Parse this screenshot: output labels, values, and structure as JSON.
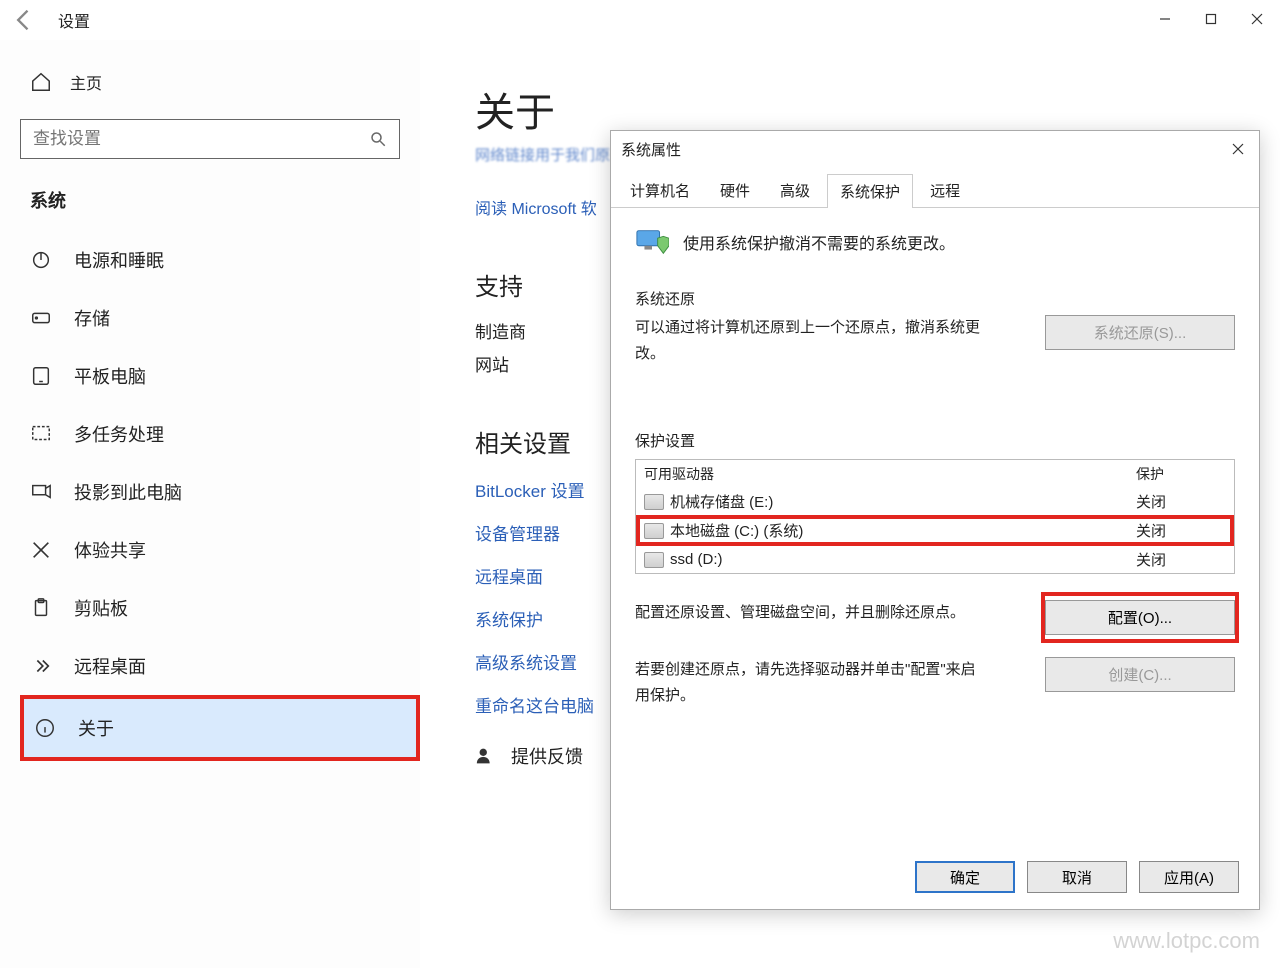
{
  "window": {
    "title": "设置"
  },
  "sidebar": {
    "home": "主页",
    "search_placeholder": "查找设置",
    "section": "系统",
    "items": [
      {
        "icon": "power-icon",
        "label": "电源和睡眠"
      },
      {
        "icon": "storage-icon",
        "label": "存储"
      },
      {
        "icon": "tablet-icon",
        "label": "平板电脑"
      },
      {
        "icon": "multitask-icon",
        "label": "多任务处理"
      },
      {
        "icon": "project-icon",
        "label": "投影到此电脑"
      },
      {
        "icon": "share-icon",
        "label": "体验共享"
      },
      {
        "icon": "clipboard-icon",
        "label": "剪贴板"
      },
      {
        "icon": "remote-icon",
        "label": "远程桌面"
      },
      {
        "icon": "info-icon",
        "label": "关于"
      }
    ]
  },
  "main": {
    "title": "关于",
    "hidden_line": "网络链接用于我们原来的 Microsoft 安全协议",
    "ms_link": "阅读 Microsoft 软",
    "support_heading": "支持",
    "manufacturer_label": "制造商",
    "website_label": "网站",
    "related_heading": "相关设置",
    "links": [
      "BitLocker 设置",
      "设备管理器",
      "远程桌面",
      "系统保护",
      "高级系统设置",
      "重命名这台电脑"
    ],
    "feedback": "提供反馈"
  },
  "dialog": {
    "title": "系统属性",
    "tabs": [
      "计算机名",
      "硬件",
      "高级",
      "系统保护",
      "远程"
    ],
    "active_tab": 3,
    "info_text": "使用系统保护撤消不需要的系统更改。",
    "restore_group": "系统还原",
    "restore_desc": "可以通过将计算机还原到上一个还原点，撤消系统更改。",
    "restore_btn": "系统还原(S)...",
    "protect_group": "保护设置",
    "drives_header": {
      "drive": "可用驱动器",
      "protection": "保护"
    },
    "drives": [
      {
        "name": "机械存储盘 (E:)",
        "protection": "关闭",
        "selected": false
      },
      {
        "name": "本地磁盘 (C:) (系统)",
        "protection": "关闭",
        "selected": true
      },
      {
        "name": "ssd (D:)",
        "protection": "关闭",
        "selected": false
      }
    ],
    "config_desc": "配置还原设置、管理磁盘空间，并且删除还原点。",
    "config_btn": "配置(O)...",
    "create_desc": "若要创建还原点，请先选择驱动器并单击\"配置\"来启用保护。",
    "create_btn": "创建(C)...",
    "footer": {
      "ok": "确定",
      "cancel": "取消",
      "apply": "应用(A)"
    }
  },
  "watermark": "www.lotpc.com"
}
